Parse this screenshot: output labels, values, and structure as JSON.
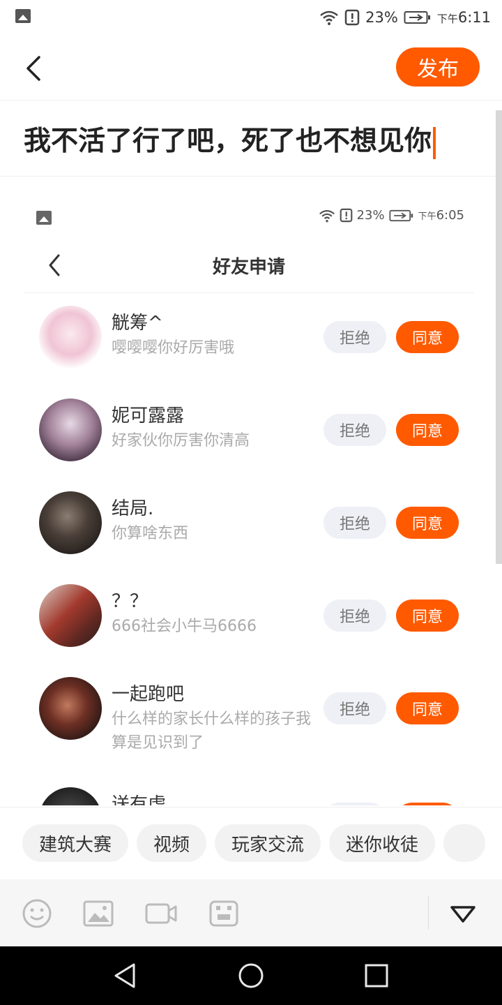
{
  "status_bar": {
    "battery": "23%",
    "time_prefix": "下午",
    "time": "6:11"
  },
  "header": {
    "publish_label": "发布"
  },
  "post": {
    "title": "我不活了行了吧，死了也不想见你"
  },
  "embedded_screenshot": {
    "status_bar": {
      "battery": "23%",
      "time_prefix": "下午",
      "time": "6:05"
    },
    "title": "好友申请",
    "reject_label": "拒绝",
    "accept_label": "同意",
    "requests": [
      {
        "name": "觥筹^",
        "message": "嘤嘤嘤你好厉害哦"
      },
      {
        "name": "妮可露露",
        "message": "好家伙你厉害你清高"
      },
      {
        "name": "结局.",
        "message": "你算啥东西"
      },
      {
        "name": "？？",
        "message": "666社会小牛马6666"
      },
      {
        "name": "一起跑吧",
        "message": "什么样的家长什么样的孩子我算是见识到了"
      },
      {
        "name": "送有虐",
        "message": ""
      }
    ]
  },
  "topics": [
    "建筑大赛",
    "视频",
    "玩家交流",
    "迷你收徒"
  ],
  "toolbar": {
    "icons": [
      "emoji-icon",
      "image-icon",
      "video-icon",
      "game-icon",
      "collapse-icon"
    ]
  },
  "colors": {
    "accent": "#ff5a00"
  }
}
